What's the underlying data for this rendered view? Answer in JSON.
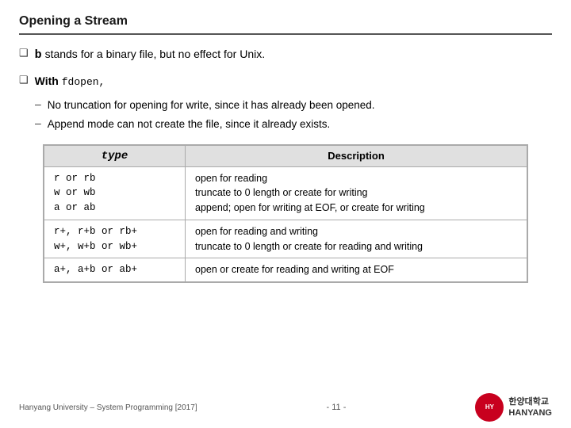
{
  "title": "Opening a Stream",
  "bullets": [
    {
      "id": "bullet1",
      "prefix": "b",
      "text": " stands for a binary file, but no effect for Unix."
    },
    {
      "id": "bullet2",
      "prefix": "With",
      "code": "fdopen,",
      "subbullets": [
        "No truncation for opening for write, since it has already been opened.",
        "Append mode can not create the file, since it already exists."
      ]
    }
  ],
  "table": {
    "col1_header": "type",
    "col2_header": "Description",
    "rows": [
      {
        "type": "r or rb\nw or wb\na or ab",
        "desc": "open for reading\ntruncate to 0 length or create for writing\nappend; open for writing at EOF, or create for writing"
      },
      {
        "type": "r+, r+b or rb+\nw+, w+b or wb+",
        "desc": "open for reading and writing\ntruncate to 0 length or create for reading and writing"
      },
      {
        "type": "a+, a+b or ab+",
        "desc": "open or create for reading and writing at EOF"
      }
    ]
  },
  "footer": {
    "left": "Hanyang University – System Programming [2017]",
    "center": "- 11 -",
    "logo_line1": "한양대학교",
    "logo_line2": "HANYANG",
    "logo_abbr": "HY"
  }
}
